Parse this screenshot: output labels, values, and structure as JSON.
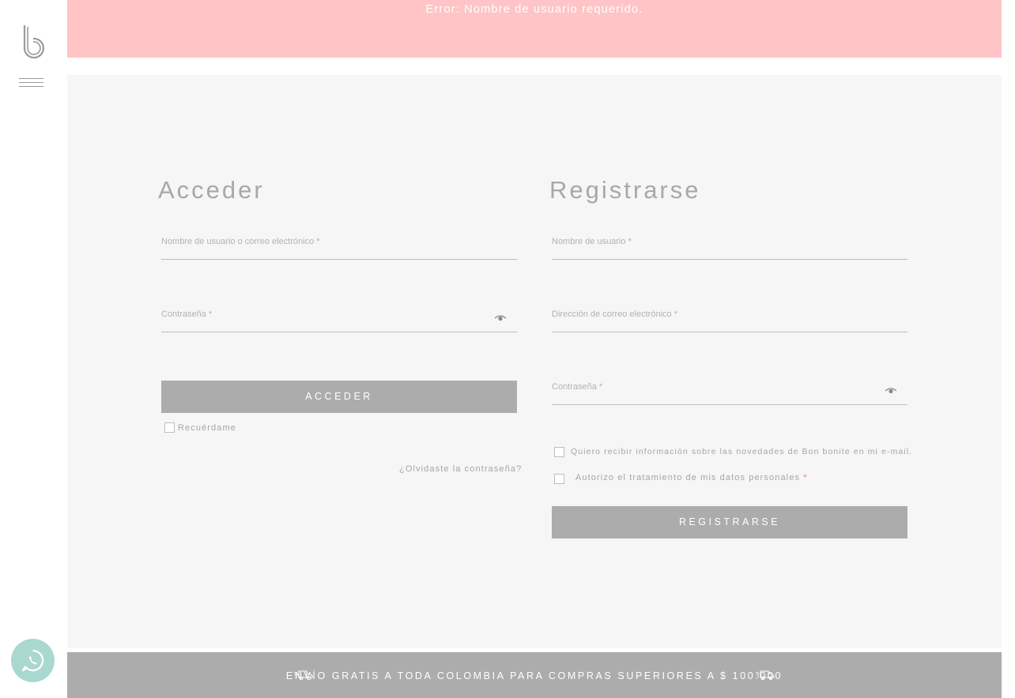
{
  "error": {
    "message": "Error: Nombre de usuario requerido."
  },
  "login": {
    "title": "Acceder",
    "username_label": "Nombre de usuario o correo electrónico *",
    "password_label": "Contraseña *",
    "submit_label": "ACCEDER",
    "remember_label": "Recuérdame",
    "forgot_link": "¿Olvidaste la contraseña?"
  },
  "register": {
    "title": "Registrarse",
    "username_label": "Nombre de usuario *",
    "email_label": "Dirección de correo electrónico *",
    "password_label": "Contraseña *",
    "newsletter_label": "Quiero recibir información sobre las novedades de Bon bonite en mi e-mail.",
    "privacy_label": "Autorizo el tratamiento de mis datos personales",
    "privacy_required": "*",
    "submit_label": "REGISTRARSE"
  },
  "footer": {
    "shipping_text": "ENVÍO GRATIS A TODA COLOMBIA PARA COMPRAS SUPERIORES A $ 100.000"
  },
  "icons": {
    "logo": "bon-bonite-logo",
    "menu": "hamburger-menu-icon",
    "eye": "eye-icon",
    "truck": "delivery-truck-icon",
    "whatsapp": "whatsapp-icon"
  },
  "colors": {
    "error_bg": "#ffc4c5",
    "button_bg": "#acacac",
    "panel_bg": "#f6f6f6",
    "whatsapp_bg": "#a8d8d0"
  }
}
